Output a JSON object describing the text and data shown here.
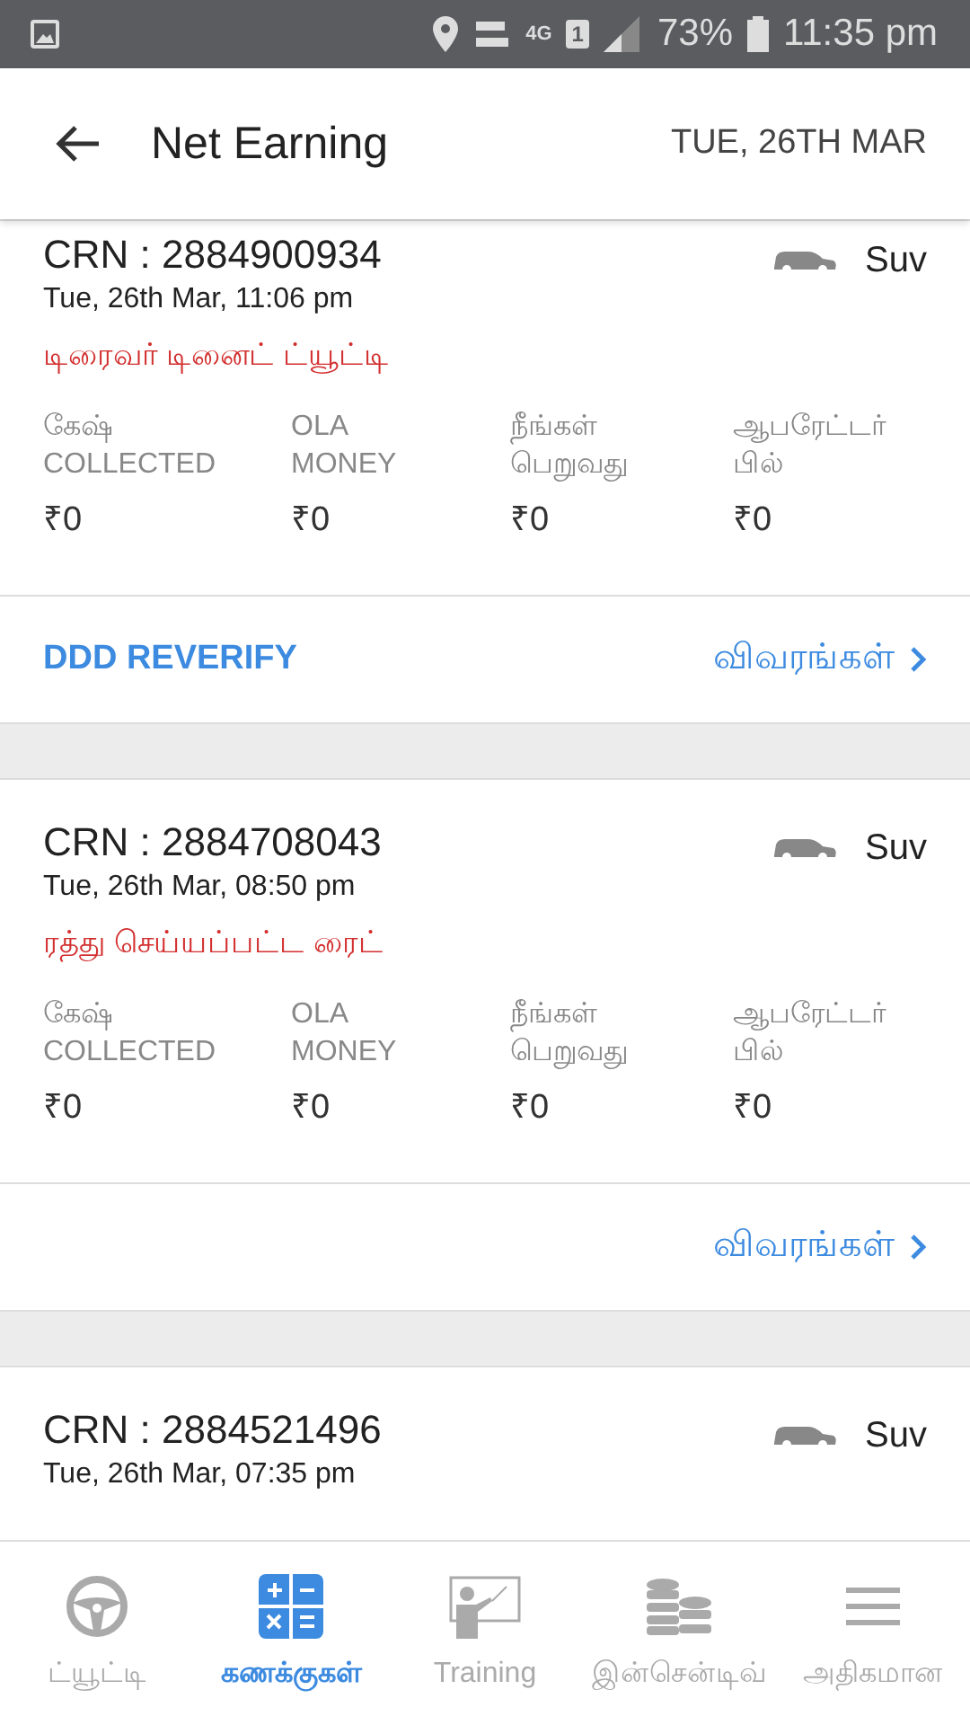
{
  "status_bar": {
    "battery": "73%",
    "time": "11:35 pm",
    "network": "4G",
    "sim": "1"
  },
  "header": {
    "title": "Net Earning",
    "date": "TUE, 26TH MAR"
  },
  "rides": [
    {
      "crn": "CRN : 2884900934",
      "datetime": "Tue, 26th Mar, 11:06 pm",
      "vehicle": "Suv",
      "status": "டிரைவர் டினைட் ட்யூட்டி",
      "amounts": [
        {
          "label": "கேஷ்\nCOLLECTED",
          "value": "₹0"
        },
        {
          "label": "OLA\nMONEY",
          "value": "₹0"
        },
        {
          "label": "நீங்கள்\nபெறுவது",
          "value": "₹0"
        },
        {
          "label": "ஆபரேட்டர்\nபில்",
          "value": "₹0"
        }
      ],
      "action": "DDD REVERIFY",
      "details": "விவரங்கள்"
    },
    {
      "crn": "CRN : 2884708043",
      "datetime": "Tue, 26th Mar, 08:50 pm",
      "vehicle": "Suv",
      "status": "ரத்து செய்யப்பட்ட ரைட்",
      "amounts": [
        {
          "label": "கேஷ்\nCOLLECTED",
          "value": "₹0"
        },
        {
          "label": "OLA\nMONEY",
          "value": "₹0"
        },
        {
          "label": "நீங்கள்\nபெறுவது",
          "value": "₹0"
        },
        {
          "label": "ஆபரேட்டர்\nபில்",
          "value": "₹0"
        }
      ],
      "details": "விவரங்கள்"
    },
    {
      "crn": "CRN : 2884521496",
      "datetime": "Tue, 26th Mar, 07:35 pm",
      "vehicle": "Suv"
    }
  ],
  "bottom_nav": [
    {
      "kind": "wheel",
      "label": "ட்யூட்டி",
      "selected": false
    },
    {
      "kind": "calculator",
      "label": "கணக்குகள்",
      "selected": true
    },
    {
      "kind": "training",
      "label": "Training",
      "selected": false
    },
    {
      "kind": "coins",
      "label": "இன்சென்டிவ்",
      "selected": false
    },
    {
      "kind": "menu",
      "label": "அதிகமான",
      "selected": false
    }
  ]
}
